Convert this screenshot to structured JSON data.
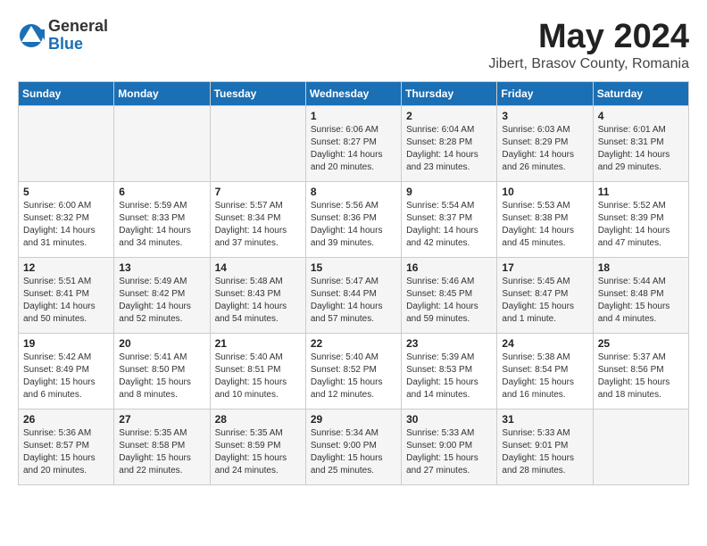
{
  "logo": {
    "general": "General",
    "blue": "Blue"
  },
  "title": "May 2024",
  "subtitle": "Jibert, Brasov County, Romania",
  "headers": [
    "Sunday",
    "Monday",
    "Tuesday",
    "Wednesday",
    "Thursday",
    "Friday",
    "Saturday"
  ],
  "weeks": [
    [
      {
        "day": "",
        "info": ""
      },
      {
        "day": "",
        "info": ""
      },
      {
        "day": "",
        "info": ""
      },
      {
        "day": "1",
        "info": "Sunrise: 6:06 AM\nSunset: 8:27 PM\nDaylight: 14 hours\nand 20 minutes."
      },
      {
        "day": "2",
        "info": "Sunrise: 6:04 AM\nSunset: 8:28 PM\nDaylight: 14 hours\nand 23 minutes."
      },
      {
        "day": "3",
        "info": "Sunrise: 6:03 AM\nSunset: 8:29 PM\nDaylight: 14 hours\nand 26 minutes."
      },
      {
        "day": "4",
        "info": "Sunrise: 6:01 AM\nSunset: 8:31 PM\nDaylight: 14 hours\nand 29 minutes."
      }
    ],
    [
      {
        "day": "5",
        "info": "Sunrise: 6:00 AM\nSunset: 8:32 PM\nDaylight: 14 hours\nand 31 minutes."
      },
      {
        "day": "6",
        "info": "Sunrise: 5:59 AM\nSunset: 8:33 PM\nDaylight: 14 hours\nand 34 minutes."
      },
      {
        "day": "7",
        "info": "Sunrise: 5:57 AM\nSunset: 8:34 PM\nDaylight: 14 hours\nand 37 minutes."
      },
      {
        "day": "8",
        "info": "Sunrise: 5:56 AM\nSunset: 8:36 PM\nDaylight: 14 hours\nand 39 minutes."
      },
      {
        "day": "9",
        "info": "Sunrise: 5:54 AM\nSunset: 8:37 PM\nDaylight: 14 hours\nand 42 minutes."
      },
      {
        "day": "10",
        "info": "Sunrise: 5:53 AM\nSunset: 8:38 PM\nDaylight: 14 hours\nand 45 minutes."
      },
      {
        "day": "11",
        "info": "Sunrise: 5:52 AM\nSunset: 8:39 PM\nDaylight: 14 hours\nand 47 minutes."
      }
    ],
    [
      {
        "day": "12",
        "info": "Sunrise: 5:51 AM\nSunset: 8:41 PM\nDaylight: 14 hours\nand 50 minutes."
      },
      {
        "day": "13",
        "info": "Sunrise: 5:49 AM\nSunset: 8:42 PM\nDaylight: 14 hours\nand 52 minutes."
      },
      {
        "day": "14",
        "info": "Sunrise: 5:48 AM\nSunset: 8:43 PM\nDaylight: 14 hours\nand 54 minutes."
      },
      {
        "day": "15",
        "info": "Sunrise: 5:47 AM\nSunset: 8:44 PM\nDaylight: 14 hours\nand 57 minutes."
      },
      {
        "day": "16",
        "info": "Sunrise: 5:46 AM\nSunset: 8:45 PM\nDaylight: 14 hours\nand 59 minutes."
      },
      {
        "day": "17",
        "info": "Sunrise: 5:45 AM\nSunset: 8:47 PM\nDaylight: 15 hours\nand 1 minute."
      },
      {
        "day": "18",
        "info": "Sunrise: 5:44 AM\nSunset: 8:48 PM\nDaylight: 15 hours\nand 4 minutes."
      }
    ],
    [
      {
        "day": "19",
        "info": "Sunrise: 5:42 AM\nSunset: 8:49 PM\nDaylight: 15 hours\nand 6 minutes."
      },
      {
        "day": "20",
        "info": "Sunrise: 5:41 AM\nSunset: 8:50 PM\nDaylight: 15 hours\nand 8 minutes."
      },
      {
        "day": "21",
        "info": "Sunrise: 5:40 AM\nSunset: 8:51 PM\nDaylight: 15 hours\nand 10 minutes."
      },
      {
        "day": "22",
        "info": "Sunrise: 5:40 AM\nSunset: 8:52 PM\nDaylight: 15 hours\nand 12 minutes."
      },
      {
        "day": "23",
        "info": "Sunrise: 5:39 AM\nSunset: 8:53 PM\nDaylight: 15 hours\nand 14 minutes."
      },
      {
        "day": "24",
        "info": "Sunrise: 5:38 AM\nSunset: 8:54 PM\nDaylight: 15 hours\nand 16 minutes."
      },
      {
        "day": "25",
        "info": "Sunrise: 5:37 AM\nSunset: 8:56 PM\nDaylight: 15 hours\nand 18 minutes."
      }
    ],
    [
      {
        "day": "26",
        "info": "Sunrise: 5:36 AM\nSunset: 8:57 PM\nDaylight: 15 hours\nand 20 minutes."
      },
      {
        "day": "27",
        "info": "Sunrise: 5:35 AM\nSunset: 8:58 PM\nDaylight: 15 hours\nand 22 minutes."
      },
      {
        "day": "28",
        "info": "Sunrise: 5:35 AM\nSunset: 8:59 PM\nDaylight: 15 hours\nand 24 minutes."
      },
      {
        "day": "29",
        "info": "Sunrise: 5:34 AM\nSunset: 9:00 PM\nDaylight: 15 hours\nand 25 minutes."
      },
      {
        "day": "30",
        "info": "Sunrise: 5:33 AM\nSunset: 9:00 PM\nDaylight: 15 hours\nand 27 minutes."
      },
      {
        "day": "31",
        "info": "Sunrise: 5:33 AM\nSunset: 9:01 PM\nDaylight: 15 hours\nand 28 minutes."
      },
      {
        "day": "",
        "info": ""
      }
    ]
  ]
}
